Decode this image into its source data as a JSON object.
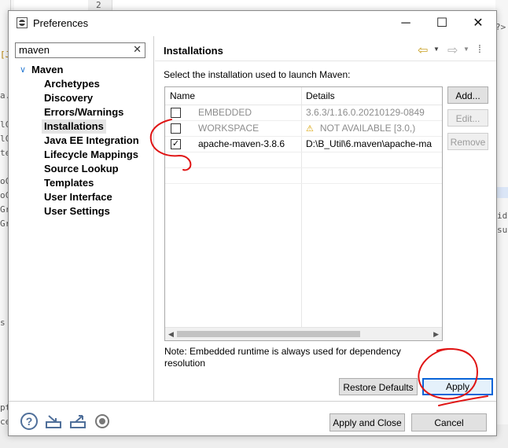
{
  "window": {
    "title": "Preferences",
    "minimize_glyph": "─",
    "maximize_glyph": "☐",
    "close_glyph": "✕"
  },
  "background": {
    "top_line_number": "2",
    "frag_right_top": "?>",
    "frag_left_1": "[J",
    "frag_left_2": "a.t",
    "frag_left_3": "lC",
    "frag_left_4": "lC",
    "frag_left_5": "te",
    "frag_left_6": "oC",
    "frag_left_7": "oC",
    "frag_left_8": "Gr",
    "frag_left_9": "Gr",
    "frag_left_10": "s",
    "frag_left_11": "pt",
    "frag_left_12": "ce",
    "frag_right_1": "id",
    "frag_right_2": "su"
  },
  "filter": {
    "value": "maven",
    "clear_glyph": "✕"
  },
  "tree": {
    "root": "Maven",
    "items": [
      {
        "label": "Archetypes",
        "selected": false
      },
      {
        "label": "Discovery",
        "selected": false
      },
      {
        "label": "Errors/Warnings",
        "selected": false
      },
      {
        "label": "Installations",
        "selected": true
      },
      {
        "label": "Java EE Integration",
        "selected": false
      },
      {
        "label": "Lifecycle Mappings",
        "selected": false
      },
      {
        "label": "Source Lookup",
        "selected": false
      },
      {
        "label": "Templates",
        "selected": false
      },
      {
        "label": "User Interface",
        "selected": false
      },
      {
        "label": "User Settings",
        "selected": false
      }
    ]
  },
  "page": {
    "title": "Installations",
    "description": "Select the installation used to launch Maven:",
    "note": "Note: Embedded runtime is always used for dependency resolution"
  },
  "table": {
    "columns": [
      "Name",
      "Details"
    ],
    "rows": [
      {
        "name": "EMBEDDED",
        "details": "3.6.3/1.16.0.20210129-0849",
        "checked": false,
        "dim": true,
        "warning": false
      },
      {
        "name": "WORKSPACE",
        "details": "NOT AVAILABLE [3.0,)",
        "checked": false,
        "dim": true,
        "warning": true
      },
      {
        "name": "apache-maven-3.8.6",
        "details": "D:\\B_Util\\6.maven\\apache-ma",
        "checked": true,
        "dim": false,
        "warning": false
      }
    ]
  },
  "buttons": {
    "add": "Add...",
    "edit": "Edit...",
    "remove": "Remove",
    "restore_defaults": "Restore Defaults",
    "apply": "Apply",
    "apply_and_close": "Apply and Close",
    "cancel": "Cancel"
  },
  "icons": {
    "help": "?",
    "checkmark": "✓",
    "warning": "⚠"
  },
  "colors": {
    "accent": "#0a64d8",
    "annotation": "#e01515",
    "warning": "#d8a200"
  }
}
